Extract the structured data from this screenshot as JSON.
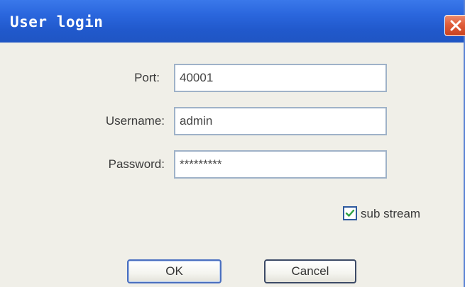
{
  "window": {
    "title": "User login"
  },
  "form": {
    "port": {
      "label": "Port:",
      "value": "40001"
    },
    "username": {
      "label": "Username:",
      "value": "admin"
    },
    "password": {
      "label": "Password:",
      "value": "*********"
    },
    "sub_stream": {
      "label": "sub stream",
      "checked": true
    }
  },
  "buttons": {
    "ok": "OK",
    "cancel": "Cancel"
  },
  "icons": {
    "close": "close-icon",
    "check": "checkmark-icon"
  },
  "colors": {
    "titlebar": "#2a66dd",
    "close_button": "#e05d3a",
    "body": "#f0efe8",
    "field_border": "#9fb2c8",
    "check": "#2ea043"
  }
}
